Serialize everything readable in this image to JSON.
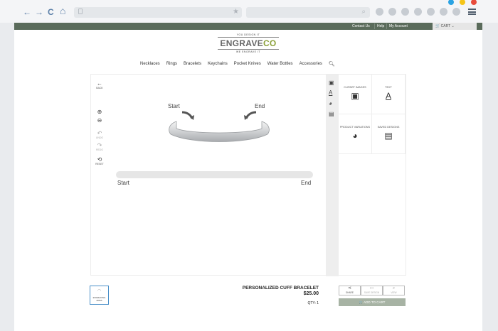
{
  "browser": {
    "nav_back": "←",
    "nav_forward": "→",
    "nav_reload": "C",
    "nav_home": "⌂",
    "star": "★",
    "search_icon": "⌕",
    "traffic": [
      "#2aa3e3",
      "#f5c518",
      "#e74c3c"
    ]
  },
  "topbar": {
    "links": [
      "Contact Us",
      "Help",
      "My Account"
    ],
    "cart_label": "CART"
  },
  "logo": {
    "tagline_top": "YOU DESIGN IT",
    "brand_a": "ENGRAVE",
    "brand_b": "CO",
    "tagline_bottom": "WE ENGRAVE IT"
  },
  "menu": {
    "items": [
      "Necklaces",
      "Rings",
      "Bracelets",
      "Keychains",
      "Pocket Knives",
      "Water Bottles",
      "Accessories"
    ]
  },
  "designer": {
    "tools": {
      "back": "BACK",
      "undo": "UNDO",
      "redo": "REDO",
      "reset": "RESET"
    },
    "labels": {
      "start_top": "Start",
      "end_top": "End",
      "start_bottom": "Start",
      "end_bottom": "End"
    },
    "panel": [
      {
        "label": "CLIPART IMAGES",
        "icon": "image-icon"
      },
      {
        "label": "TEXT",
        "icon": "text-icon"
      },
      {
        "label": "PRODUCT VARIATIONS",
        "icon": "palette-icon"
      },
      {
        "label": "SAVED DESIGNS",
        "icon": "gallery-icon"
      }
    ]
  },
  "product": {
    "thumb_label": "ENGRAVING AREA",
    "name": "PERSONALIZED CUFF BRACELET",
    "price": "$25.00",
    "qty": "QTY: 1",
    "actions": [
      "SHARE",
      "SAVE DESIGN",
      "VIEW"
    ],
    "add_to_cart": "ADD TO CART"
  }
}
